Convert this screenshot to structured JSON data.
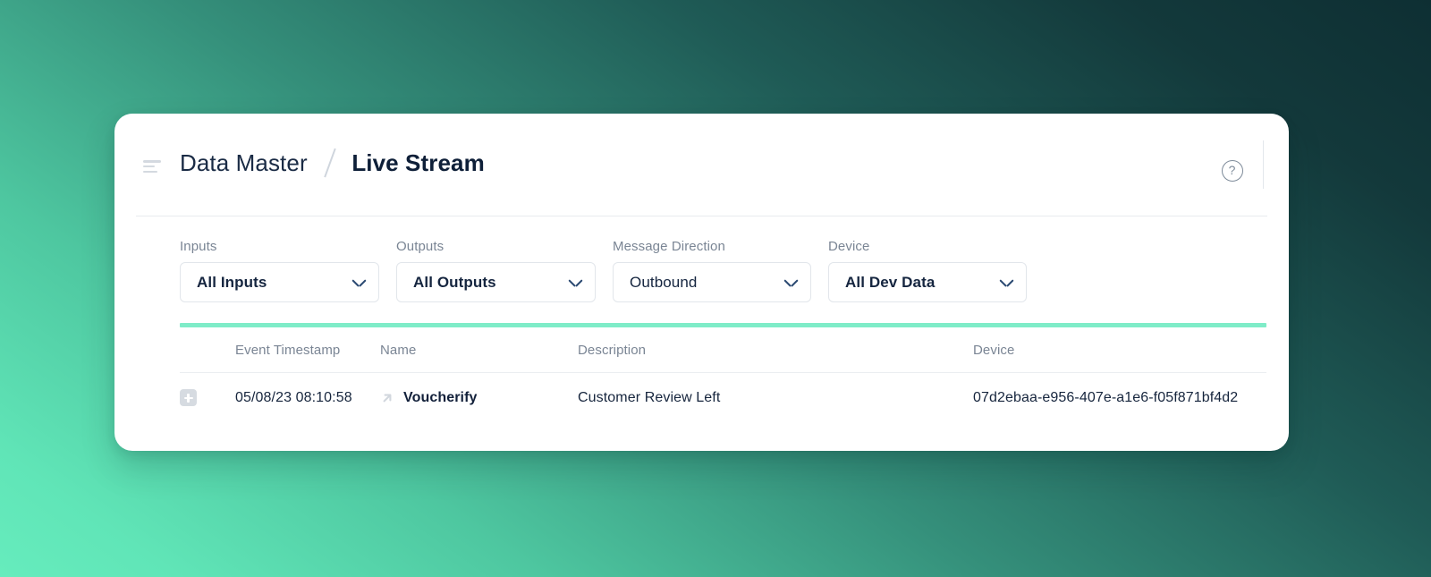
{
  "theme": {
    "accent_green": "#7fecc8",
    "gradient_from": "#0e2f33",
    "gradient_to": "#66ecbd",
    "card_background": "#ffffff",
    "text_dark": "#16253d",
    "text_muted": "#7a8594"
  },
  "header": {
    "menu_icon": "align-left-icon",
    "breadcrumb_root": "Data Master",
    "breadcrumb_separator": "/",
    "breadcrumb_current": "Live Stream",
    "help_icon": "question-circle-icon",
    "help_label": "?"
  },
  "filters": [
    {
      "key": "inputs",
      "label": "Inputs",
      "value": "All Inputs",
      "bold": true,
      "chevron": "chevron-down-icon"
    },
    {
      "key": "outputs",
      "label": "Outputs",
      "value": "All Outputs",
      "bold": true,
      "chevron": "chevron-down-icon"
    },
    {
      "key": "message_direction",
      "label": "Message Direction",
      "value": "Outbound",
      "bold": false,
      "chevron": "chevron-down-icon"
    },
    {
      "key": "device",
      "label": "Device",
      "value": "All Dev Data",
      "bold": true,
      "chevron": "chevron-down-icon"
    }
  ],
  "table": {
    "columns": [
      {
        "key": "expand",
        "label": ""
      },
      {
        "key": "timestamp",
        "label": "Event Timestamp"
      },
      {
        "key": "name",
        "label": "Name"
      },
      {
        "key": "description",
        "label": "Description"
      },
      {
        "key": "device",
        "label": "Device"
      }
    ],
    "rows": [
      {
        "expand_icon": "plus-square-icon",
        "timestamp": "05/08/23 08:10:58",
        "direction_icon": "arrow-up-right-icon",
        "name": "Voucherify",
        "description": "Customer Review Left",
        "device": "07d2ebaa-e956-407e-a1e6-f05f871bf4d2"
      }
    ]
  }
}
